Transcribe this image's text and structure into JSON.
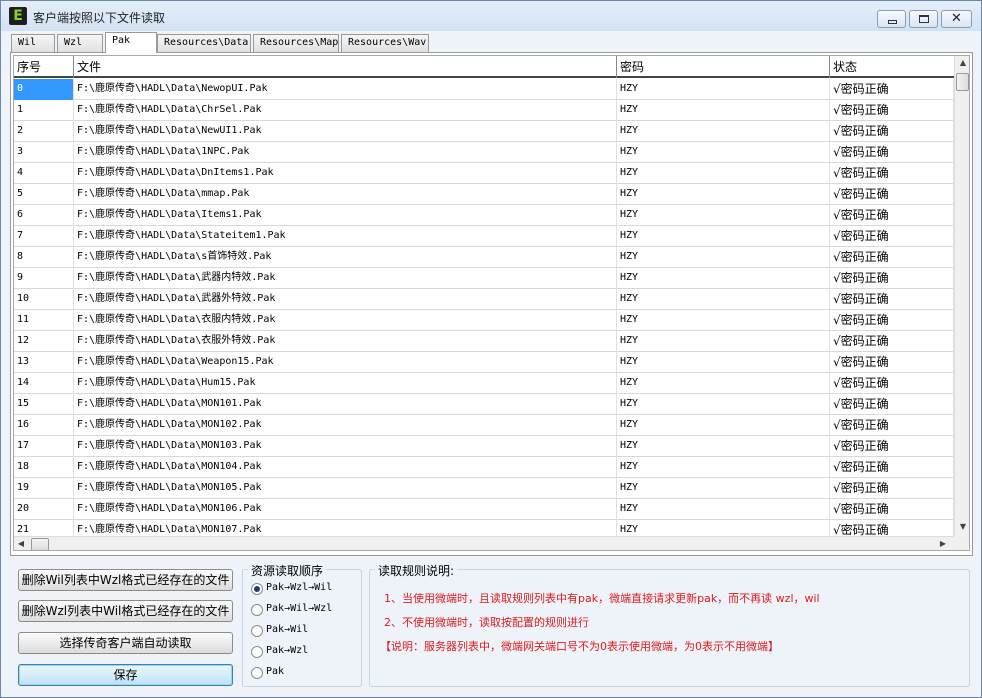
{
  "window": {
    "title": "客户端按照以下文件读取",
    "icon_letter": "E",
    "icon_name": "app-e-icon"
  },
  "tabs": [
    {
      "label": "Wil",
      "active": false
    },
    {
      "label": "Wzl",
      "active": false
    },
    {
      "label": "Pak",
      "active": true
    },
    {
      "label": "Resources\\Data",
      "active": false
    },
    {
      "label": "Resources\\Map",
      "active": false
    },
    {
      "label": "Resources\\Wav",
      "active": false
    }
  ],
  "table": {
    "columns": [
      "序号",
      "文件",
      "密码",
      "状态"
    ],
    "rows": [
      {
        "index": "0",
        "file": "F:\\鹿原传奇\\HADL\\Data\\NewopUI.Pak",
        "password": "HZY",
        "status": "√密码正确"
      },
      {
        "index": "1",
        "file": "F:\\鹿原传奇\\HADL\\Data\\ChrSel.Pak",
        "password": "HZY",
        "status": "√密码正确"
      },
      {
        "index": "2",
        "file": "F:\\鹿原传奇\\HADL\\Data\\NewUI1.Pak",
        "password": "HZY",
        "status": "√密码正确"
      },
      {
        "index": "3",
        "file": "F:\\鹿原传奇\\HADL\\Data\\1NPC.Pak",
        "password": "HZY",
        "status": "√密码正确"
      },
      {
        "index": "4",
        "file": "F:\\鹿原传奇\\HADL\\Data\\DnItems1.Pak",
        "password": "HZY",
        "status": "√密码正确"
      },
      {
        "index": "5",
        "file": "F:\\鹿原传奇\\HADL\\Data\\mmap.Pak",
        "password": "HZY",
        "status": "√密码正确"
      },
      {
        "index": "6",
        "file": "F:\\鹿原传奇\\HADL\\Data\\Items1.Pak",
        "password": "HZY",
        "status": "√密码正确"
      },
      {
        "index": "7",
        "file": "F:\\鹿原传奇\\HADL\\Data\\Stateitem1.Pak",
        "password": "HZY",
        "status": "√密码正确"
      },
      {
        "index": "8",
        "file": "F:\\鹿原传奇\\HADL\\Data\\s首饰特效.Pak",
        "password": "HZY",
        "status": "√密码正确"
      },
      {
        "index": "9",
        "file": "F:\\鹿原传奇\\HADL\\Data\\武器内特效.Pak",
        "password": "HZY",
        "status": "√密码正确"
      },
      {
        "index": "10",
        "file": "F:\\鹿原传奇\\HADL\\Data\\武器外特效.Pak",
        "password": "HZY",
        "status": "√密码正确"
      },
      {
        "index": "11",
        "file": "F:\\鹿原传奇\\HADL\\Data\\衣服内特效.Pak",
        "password": "HZY",
        "status": "√密码正确"
      },
      {
        "index": "12",
        "file": "F:\\鹿原传奇\\HADL\\Data\\衣服外特效.Pak",
        "password": "HZY",
        "status": "√密码正确"
      },
      {
        "index": "13",
        "file": "F:\\鹿原传奇\\HADL\\Data\\Weapon15.Pak",
        "password": "HZY",
        "status": "√密码正确"
      },
      {
        "index": "14",
        "file": "F:\\鹿原传奇\\HADL\\Data\\Hum15.Pak",
        "password": "HZY",
        "status": "√密码正确"
      },
      {
        "index": "15",
        "file": "F:\\鹿原传奇\\HADL\\Data\\MON101.Pak",
        "password": "HZY",
        "status": "√密码正确"
      },
      {
        "index": "16",
        "file": "F:\\鹿原传奇\\HADL\\Data\\MON102.Pak",
        "password": "HZY",
        "status": "√密码正确"
      },
      {
        "index": "17",
        "file": "F:\\鹿原传奇\\HADL\\Data\\MON103.Pak",
        "password": "HZY",
        "status": "√密码正确"
      },
      {
        "index": "18",
        "file": "F:\\鹿原传奇\\HADL\\Data\\MON104.Pak",
        "password": "HZY",
        "status": "√密码正确"
      },
      {
        "index": "19",
        "file": "F:\\鹿原传奇\\HADL\\Data\\MON105.Pak",
        "password": "HZY",
        "status": "√密码正确"
      },
      {
        "index": "20",
        "file": "F:\\鹿原传奇\\HADL\\Data\\MON106.Pak",
        "password": "HZY",
        "status": "√密码正确"
      },
      {
        "index": "21",
        "file": "F:\\鹿原传奇\\HADL\\Data\\MON107.Pak",
        "password": "HZY",
        "status": "√密码正确"
      }
    ]
  },
  "buttons": {
    "delete_wil": "删除Wil列表中Wzl格式已经存在的文件",
    "delete_wzl": "删除Wzl列表中Wil格式已经存在的文件",
    "auto_read": "选择传奇客户端自动读取",
    "save": "保存"
  },
  "order_group": {
    "title": "资源读取顺序",
    "options": [
      {
        "label": "Pak→Wzl→Wil",
        "checked": true
      },
      {
        "label": "Pak→Wil→Wzl",
        "checked": false
      },
      {
        "label": "Pak→Wil",
        "checked": false
      },
      {
        "label": "Pak→Wzl",
        "checked": false
      },
      {
        "label": "Pak",
        "checked": false
      }
    ]
  },
  "rules_group": {
    "title": "读取规则说明:",
    "lines": [
      "1、当使用微端时，且读取规则列表中有pak，微端直接请求更新pak，而不再读 wzl，wil",
      "2、不使用微端时，读取按配置的规则进行",
      "【说明：服务器列表中，微端网关端口号不为0表示使用微端，为0表示不用微端】"
    ]
  },
  "colors": {
    "selection": "#3399ff",
    "rules_text": "#e01b1b",
    "window_bg": "#eef3fa"
  }
}
